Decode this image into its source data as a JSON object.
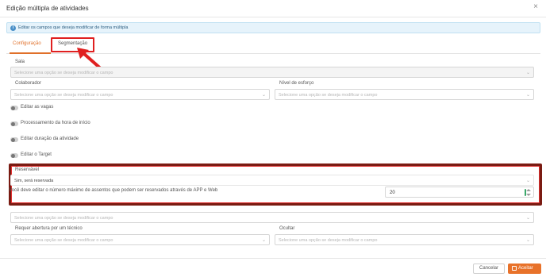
{
  "dialog": {
    "title": "Edição múltipla de atividades",
    "close_icon": "×"
  },
  "info": {
    "icon": "info-icon",
    "text": "Editar os campos que deseja modificar de forma múltipla"
  },
  "tabs": [
    {
      "label": "Configuração",
      "active": true
    },
    {
      "label": "Segmentação",
      "active": false
    }
  ],
  "fields": {
    "sala": {
      "label": "Sala",
      "placeholder": "Selecione uma opção se deseja modificar o campo"
    },
    "colaborador": {
      "label": "Colaborador",
      "placeholder": "Selecione uma opção se deseja modificar o campo"
    },
    "nivel_esforco": {
      "label": "Nível de esforço",
      "placeholder": "Selecione uma opção se deseja modificar o campo"
    },
    "reservavel": {
      "label": "Reservável",
      "value": "Sim, será reservada"
    },
    "assentos": {
      "label": "Você deve editar o número máximo de assentos que podem ser reservados através de APP e Web",
      "value": "20"
    },
    "hidden_field": {
      "placeholder": "Selecione uma opção se deseja modificar o campo"
    },
    "requer_abertura": {
      "label": "Requer abertura por um técnico",
      "placeholder": "Selecione uma opção se deseja modificar o campo"
    },
    "ocultar": {
      "label": "Ocultar",
      "placeholder": "Selecione uma opção se deseja modificar o campo"
    }
  },
  "toggles": [
    {
      "label": "Editar as vagas"
    },
    {
      "label": "Processamento da hora de início"
    },
    {
      "label": "Editar duração da atividade"
    },
    {
      "label": "Editar o Target"
    }
  ],
  "footer": {
    "cancel_label": "Cancelar",
    "accept_label": "Aceitar"
  },
  "colors": {
    "accent": "#e8722a",
    "highlight": "#e02020",
    "highlight_dark": "#7a1b12",
    "info_bg": "#e6f3fb"
  }
}
